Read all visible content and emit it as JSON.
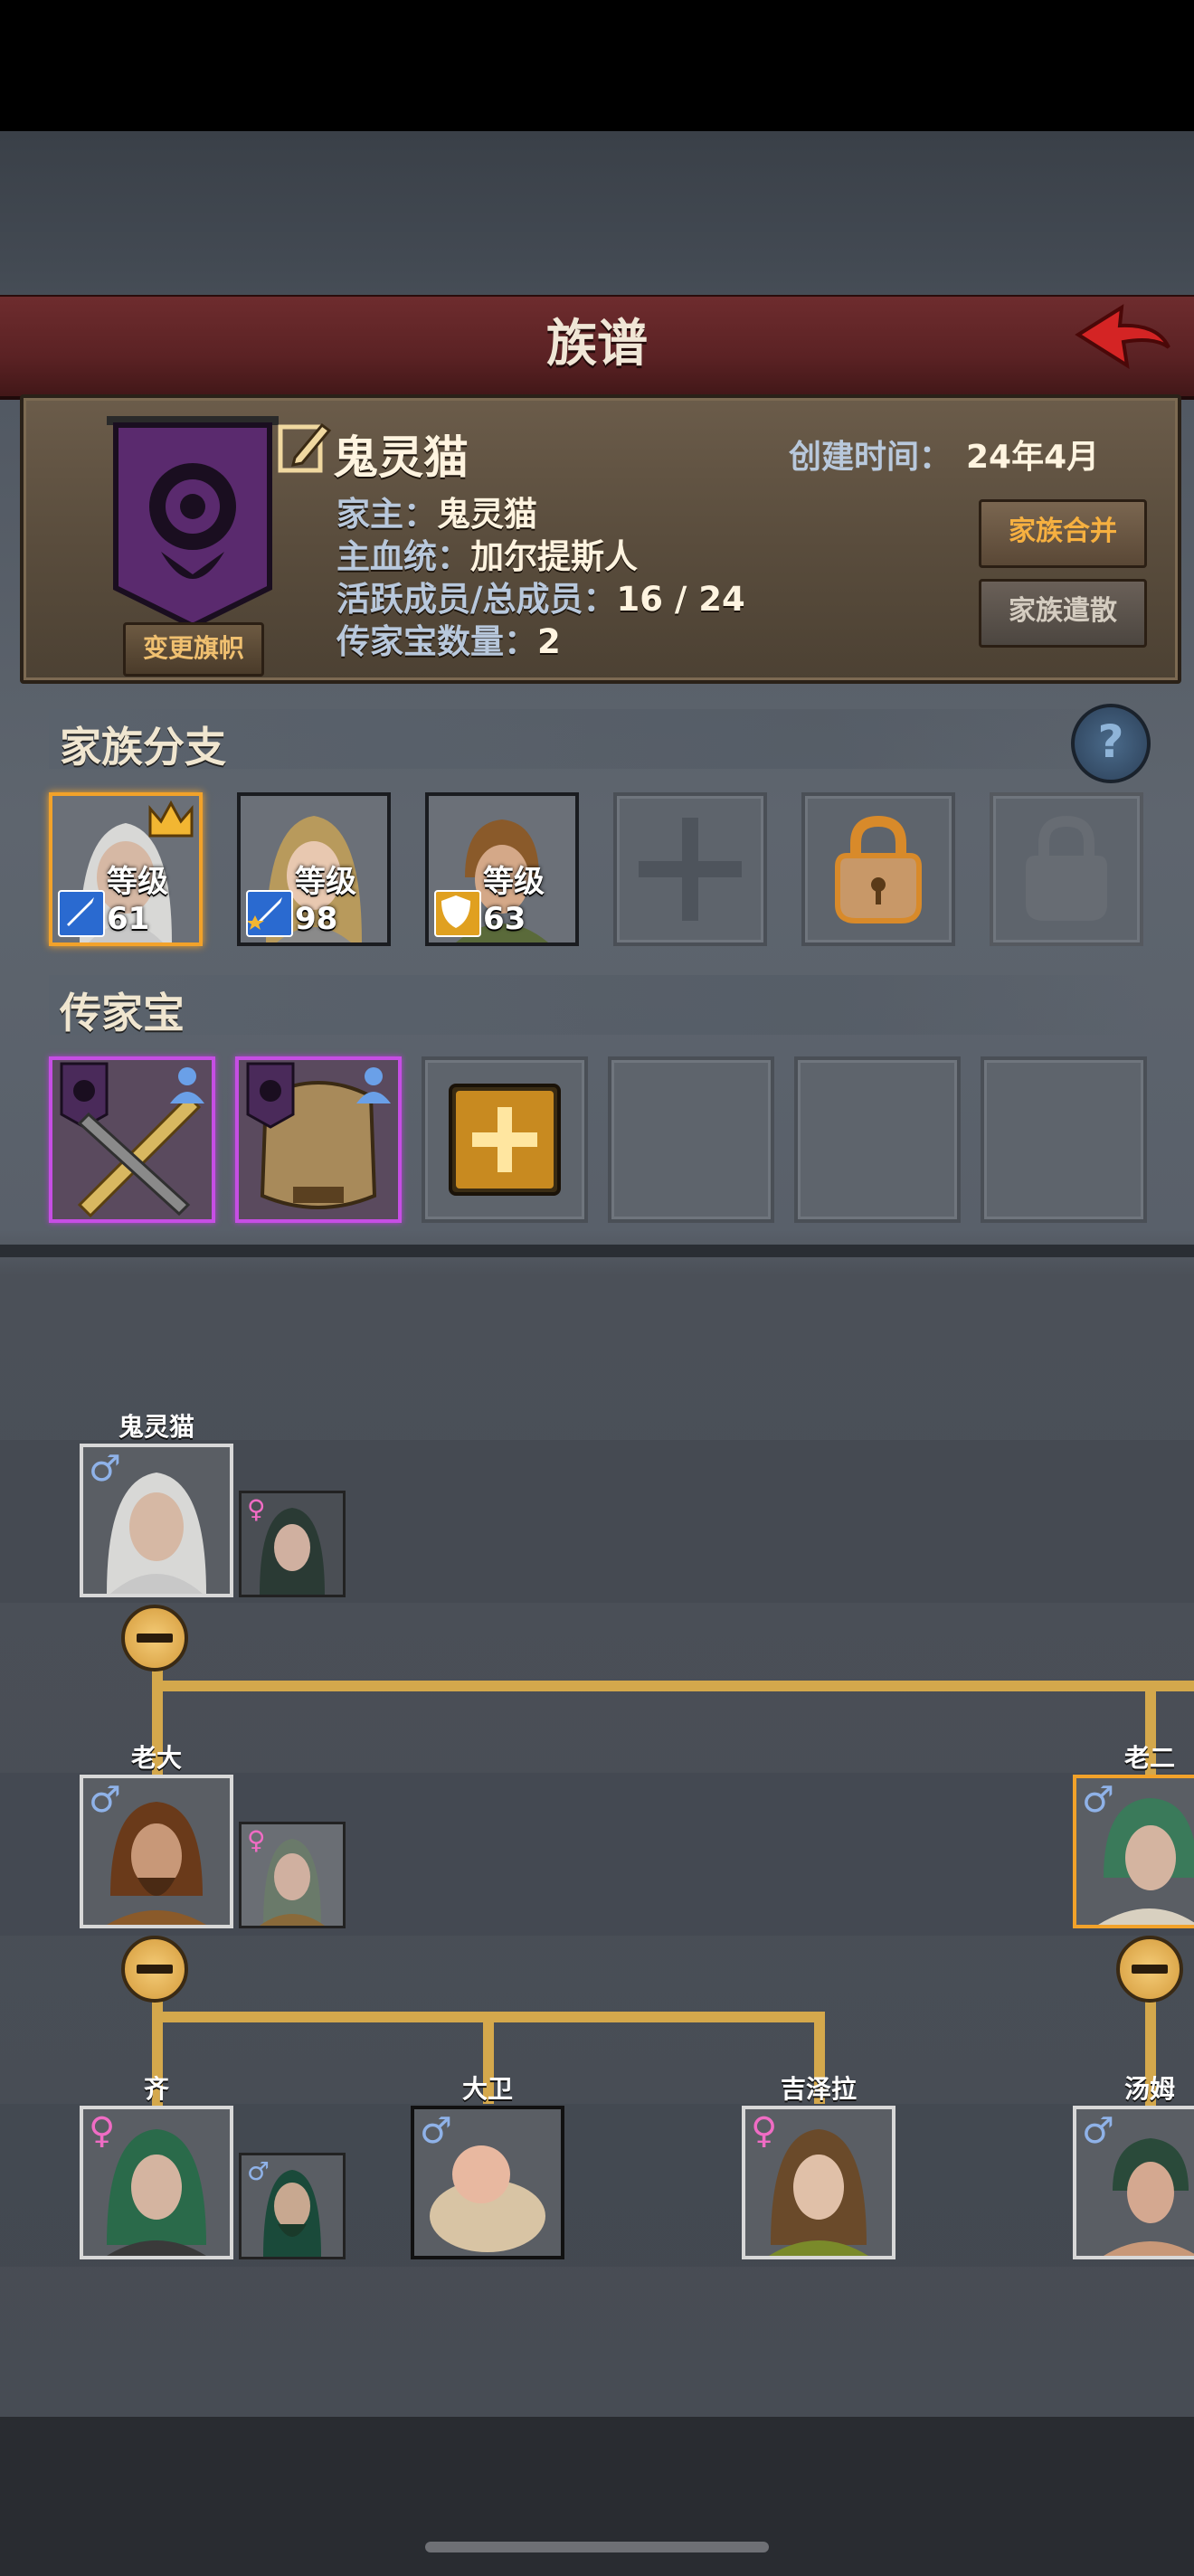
{
  "header": {
    "title": "族谱"
  },
  "family": {
    "name": "鬼灵猫",
    "created_label": "创建时间：",
    "created_value": "24年4月",
    "head_label": "家主：",
    "head_value": "鬼灵猫",
    "bloodline_label": "主血统：",
    "bloodline_value": "加尔提斯人",
    "members_label": "活跃成员/总成员：",
    "members_value": "16 / 24",
    "heirloom_count_label": "传家宝数量：",
    "heirloom_count_value": "2",
    "change_flag_label": "变更旗帜",
    "merge_label": "家族合并",
    "disband_label": "家族遣散"
  },
  "branches": {
    "title": "家族分支",
    "help_label": "?",
    "items": [
      {
        "level": "等级61",
        "role": "sword",
        "crown": true
      },
      {
        "level": "等级98",
        "role": "sword-star"
      },
      {
        "level": "等级63",
        "role": "shield"
      }
    ]
  },
  "heirlooms": {
    "title": "传家宝",
    "items": [
      {
        "name": "weapon"
      },
      {
        "name": "armor"
      }
    ]
  },
  "tree": {
    "gen1": {
      "name": "鬼灵猫",
      "gender": "♂",
      "spouse_gender": "♀"
    },
    "gen2": [
      {
        "name": "老大",
        "gender": "♂",
        "spouse_gender": "♀"
      },
      {
        "name": "老二",
        "gender": "♂"
      }
    ],
    "gen3": [
      {
        "name": "齐",
        "gender": "♀",
        "spouse_gender": "♂"
      },
      {
        "name": "大卫",
        "gender": "♂"
      },
      {
        "name": "吉泽拉",
        "gender": "♀"
      },
      {
        "name": "汤姆",
        "gender": "♂"
      }
    ]
  },
  "colors": {
    "accent_gold": "#f2a22a",
    "heirloom_purple": "#c64ee4",
    "banner_red": "#6e2c2e"
  }
}
